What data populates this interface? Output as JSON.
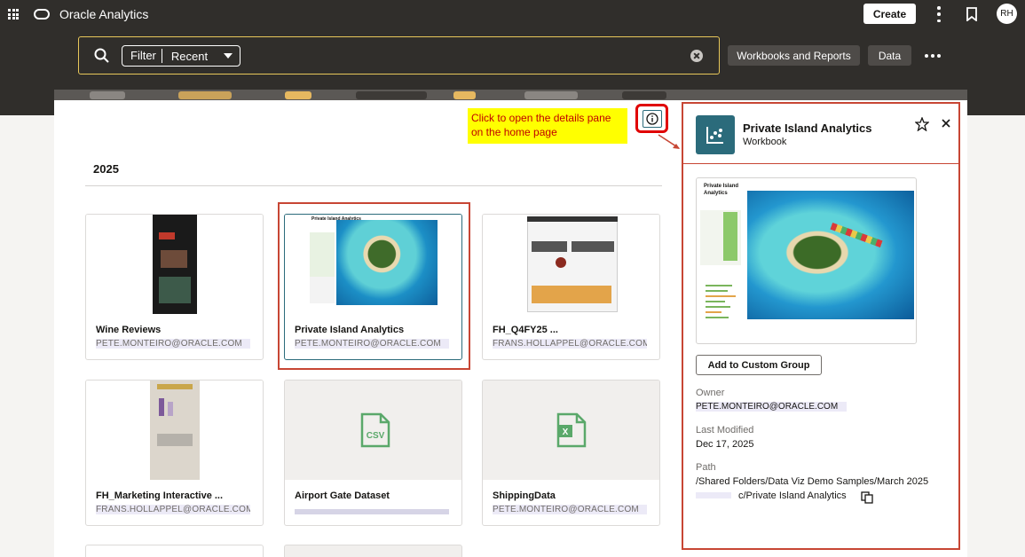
{
  "app": {
    "title": "Oracle Analytics"
  },
  "topbar": {
    "create_label": "Create",
    "avatar_initials": "RH"
  },
  "search": {
    "filter_label": "Filter",
    "filter_value": "Recent",
    "buttons": [
      "Workbooks and Reports",
      "Data"
    ]
  },
  "main": {
    "year": "2025",
    "cards": [
      {
        "name": "Wine Reviews",
        "owner": "PETE.MONTEIRO@ORACLE.COM"
      },
      {
        "name": "Private Island Analytics",
        "owner": "PETE.MONTEIRO@ORACLE.COM"
      },
      {
        "name": "FH_Q4FY25 ...",
        "owner": "FRANS.HOLLAPPEL@ORACLE.COM"
      },
      {
        "name": "FH_Marketing Interactive ...",
        "owner": "FRANS.HOLLAPPEL@ORACLE.COM"
      },
      {
        "name": "Airport Gate Dataset",
        "owner": ""
      },
      {
        "name": "ShippingData",
        "owner": "PETE.MONTEIRO@ORACLE.COM"
      }
    ]
  },
  "callout": {
    "text": "Click to open the details pane on the home page"
  },
  "details": {
    "title": "Private Island Analytics",
    "type": "Workbook",
    "add_button": "Add to Custom Group",
    "owner_label": "Owner",
    "owner_value": "PETE.MONTEIRO@ORACLE.COM",
    "modified_label": "Last Modified",
    "modified_value": "Dec 17, 2025",
    "path_label": "Path",
    "path_line1": "/Shared Folders/Data Viz Demo Samples/March 2025",
    "path_line2": "c/Private Island Analytics",
    "thumb_title": "Private Island Analytics"
  },
  "icons": {
    "apps": "grid-icon",
    "logo": "oracle-logo-icon",
    "search": "search-icon",
    "clear": "clear-icon",
    "more": "more-icon",
    "info": "info-icon",
    "star": "star-icon",
    "close": "close-icon",
    "copy": "copy-icon",
    "csv": "csv-file-icon",
    "excel": "excel-file-icon",
    "workbook": "workbook-icon"
  },
  "colors": {
    "accent": "#2b6b7b",
    "highlight": "#c74634",
    "callout_bg": "#ffff00",
    "callout_text": "#c00000",
    "topbar": "#302e2b"
  }
}
